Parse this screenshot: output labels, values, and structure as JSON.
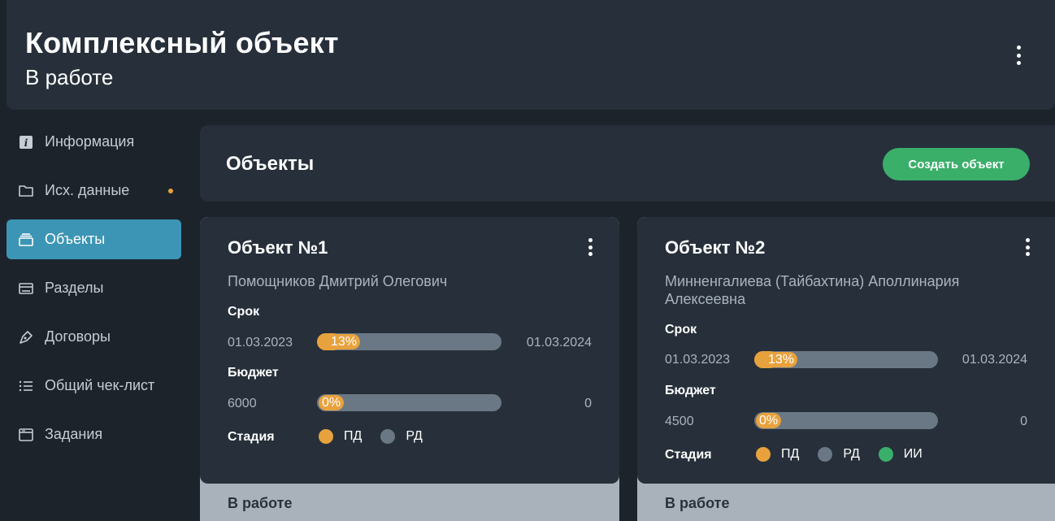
{
  "header": {
    "title": "Комплексный объект",
    "status": "В работе"
  },
  "sidebar": {
    "items": [
      {
        "label": "Информация",
        "icon": "info-icon"
      },
      {
        "label": "Исх. данные",
        "icon": "folder-icon",
        "dot_color": "#e8a23d"
      },
      {
        "label": "Объекты",
        "icon": "objects-icon",
        "active": true
      },
      {
        "label": "Разделы",
        "icon": "sections-icon"
      },
      {
        "label": "Договоры",
        "icon": "pen-icon"
      },
      {
        "label": "Общий чек-лист",
        "icon": "checklist-icon"
      },
      {
        "label": "Задания",
        "icon": "tasks-icon"
      }
    ]
  },
  "objects": {
    "title": "Объекты",
    "create_label": "Создать объект"
  },
  "cards": [
    {
      "title": "Объект №1",
      "person": "Помощников Дмитрий Олегович",
      "term_label": "Срок",
      "term_start": "01.03.2023",
      "term_end": "01.03.2024",
      "term_progress": "13%",
      "term_fraction": 0.13,
      "budget_label": "Бюджет",
      "budget_start": "6000",
      "budget_end": "0",
      "budget_progress": "0%",
      "budget_fraction": 0,
      "stage_label": "Стадия",
      "stages": [
        {
          "label": "ПД",
          "color": "#e8a23d"
        },
        {
          "label": "РД",
          "color": "#6a7885"
        }
      ],
      "footer": "В работе"
    },
    {
      "title": "Объект №2",
      "person": "Минненгалиева (Тайбахтина) Аполлинария Алексеевна",
      "term_label": "Срок",
      "term_start": "01.03.2023",
      "term_end": "01.03.2024",
      "term_progress": "13%",
      "term_fraction": 0.13,
      "budget_label": "Бюджет",
      "budget_start": "4500",
      "budget_end": "0",
      "budget_progress": "0%",
      "budget_fraction": 0,
      "stage_label": "Стадия",
      "stages": [
        {
          "label": "ПД",
          "color": "#e8a23d"
        },
        {
          "label": "РД",
          "color": "#6a7885"
        },
        {
          "label": "ИИ",
          "color": "#3aaf6a"
        }
      ],
      "footer": "В работе"
    }
  ],
  "colors": {
    "accent": "#3c95b5",
    "create": "#3aaf6a",
    "warning": "#e8a23d"
  }
}
